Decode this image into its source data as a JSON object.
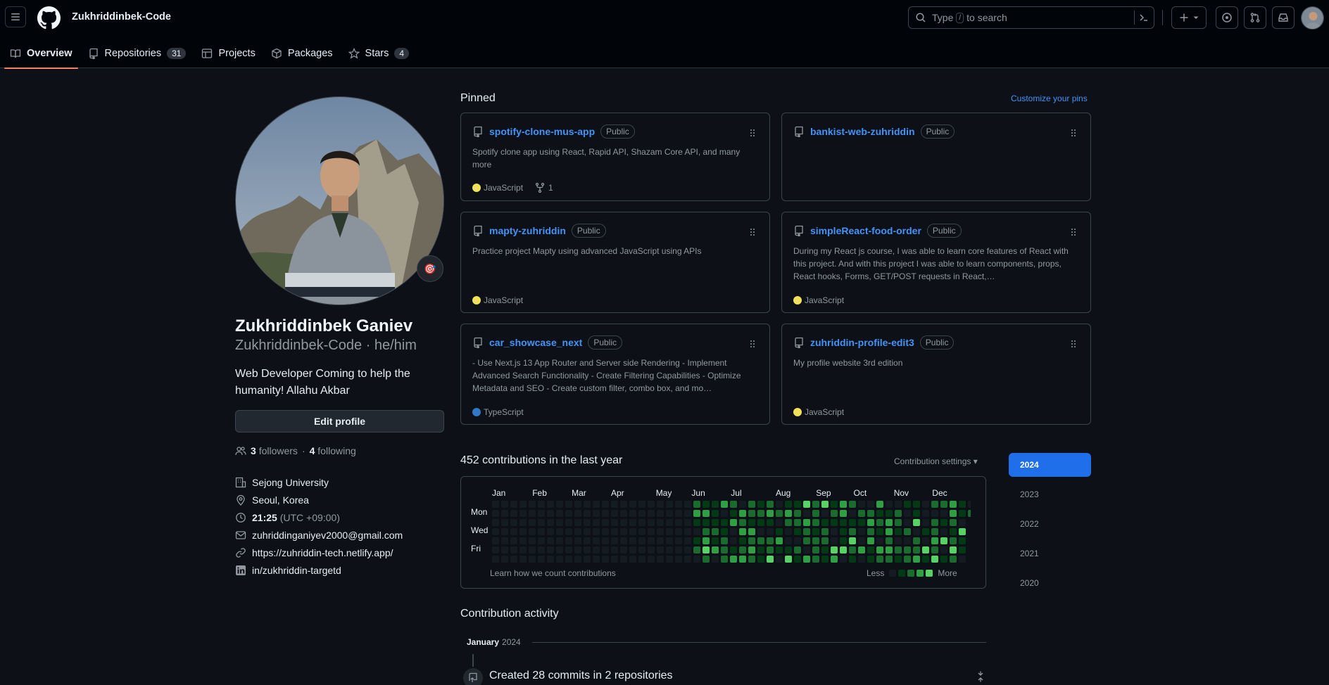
{
  "header": {
    "owner": "Zukhriddinbek-Code",
    "search_prefix": "Type",
    "search_key": "/",
    "search_suffix": "to search"
  },
  "tabs": [
    {
      "label": "Overview",
      "active": true,
      "icon": "book-icon"
    },
    {
      "label": "Repositories",
      "count": "31",
      "icon": "repo-icon"
    },
    {
      "label": "Projects",
      "icon": "table-icon"
    },
    {
      "label": "Packages",
      "icon": "package-icon"
    },
    {
      "label": "Stars",
      "count": "4",
      "icon": "star-icon"
    }
  ],
  "profile": {
    "full_name": "Zukhriddinbek Ganiev",
    "login_line": "Zukhriddinbek-Code · he/him",
    "bio": "Web Developer Coming to help the humanity! Allahu Akbar",
    "edit_label": "Edit profile",
    "followers_count": "3",
    "followers_label": "followers",
    "separator": "·",
    "following_count": "4",
    "following_label": "following",
    "status_emoji": "🎯",
    "organization": "Sejong University",
    "location": "Seoul, Korea",
    "time": "21:25",
    "timezone": "(UTC +09:00)",
    "email": "zuhriddinganiyev2000@gmail.com",
    "website": "https://zuhriddin-tech.netlify.app/",
    "linkedin": "in/zukhriddin-targetd"
  },
  "pinned": {
    "title": "Pinned",
    "customize": "Customize your pins",
    "repos": [
      {
        "name": "spotify-clone-mus-app",
        "visibility": "Public",
        "description": "Spotify clone app using React, Rapid API, Shazam Core API, and many more",
        "language": "JavaScript",
        "lang_color": "#f1e05a",
        "forks": "1"
      },
      {
        "name": "bankist-web-zuhriddin",
        "visibility": "Public",
        "description": "",
        "language": "",
        "lang_color": "",
        "forks": ""
      },
      {
        "name": "mapty-zuhriddin",
        "visibility": "Public",
        "description": "Practice project Mapty using advanced JavaScript using APIs",
        "language": "JavaScript",
        "lang_color": "#f1e05a",
        "forks": ""
      },
      {
        "name": "simpleReact-food-order",
        "visibility": "Public",
        "description": "During my React js course, I was able to learn core features of React with this project. And with this project I was able to learn components, props, React hooks, Forms, GET/POST requests in React,…",
        "language": "JavaScript",
        "lang_color": "#f1e05a",
        "forks": ""
      },
      {
        "name": "car_showcase_next",
        "visibility": "Public",
        "description": "- Use Next.js 13 App Router and Server side Rendering - Implement Advanced Search Functionality - Create Filtering Capabilities - Optimize Metadata and SEO - Create custom filter, combo box, and mo…",
        "language": "TypeScript",
        "lang_color": "#3178c6",
        "forks": ""
      },
      {
        "name": "zuhriddin-profile-edit3",
        "visibility": "Public",
        "description": "My profile website 3rd edition",
        "language": "JavaScript",
        "lang_color": "#f1e05a",
        "forks": ""
      }
    ]
  },
  "contributions": {
    "title": "452 contributions in the last year",
    "settings": "Contribution settings",
    "months": [
      "Jan",
      "Feb",
      "Mar",
      "Apr",
      "May",
      "Jun",
      "Jul",
      "Aug",
      "Sep",
      "Oct",
      "Nov",
      "Dec"
    ],
    "days": [
      "Mon",
      "Wed",
      "Fri"
    ],
    "learn": "Learn how we count contributions",
    "less": "Less",
    "more": "More",
    "level_colors": [
      "#151b23",
      "#033a16",
      "#196c2e",
      "#2ea043",
      "#56d364"
    ],
    "active_from_week": 22,
    "weeks": 53
  },
  "years": [
    "2024",
    "2023",
    "2022",
    "2021",
    "2020"
  ],
  "activity": {
    "title": "Contribution activity",
    "month": "January",
    "year": "2024",
    "item": "Created 28 commits in 2 repositories"
  }
}
